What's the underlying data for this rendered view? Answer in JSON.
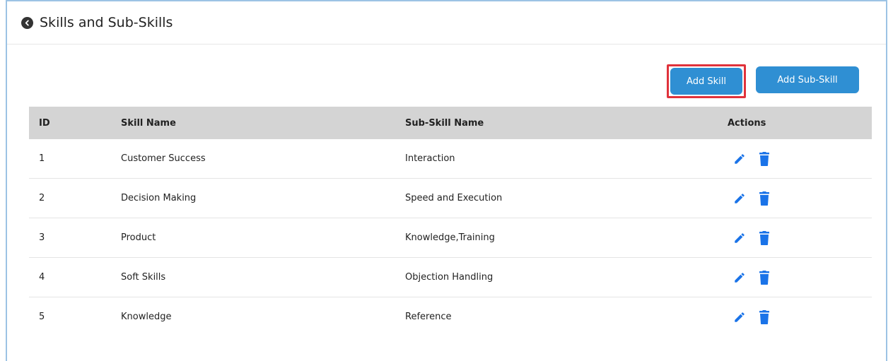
{
  "header": {
    "title": "Skills and Sub-Skills",
    "back_icon": "chevron-left-circle-icon"
  },
  "toolbar": {
    "add_skill_label": "Add Skill",
    "add_subskill_label": "Add Sub-Skill",
    "button_color": "#2f8fd3",
    "highlight_color": "#e0323b"
  },
  "table": {
    "columns": [
      "ID",
      "Skill Name",
      "Sub-Skill Name",
      "Actions"
    ],
    "rows": [
      {
        "id": "1",
        "skill": "Customer Success",
        "sub_skill": "Interaction"
      },
      {
        "id": "2",
        "skill": "Decision Making",
        "sub_skill": "Speed and Execution"
      },
      {
        "id": "3",
        "skill": "Product",
        "sub_skill": "Knowledge,Training"
      },
      {
        "id": "4",
        "skill": "Soft Skills",
        "sub_skill": "Objection Handling"
      },
      {
        "id": "5",
        "skill": "Knowledge",
        "sub_skill": "Reference"
      }
    ],
    "row_actions": [
      "edit-pencil-icon",
      "delete-trash-icon"
    ],
    "action_icon_color": "#1a73e8"
  }
}
